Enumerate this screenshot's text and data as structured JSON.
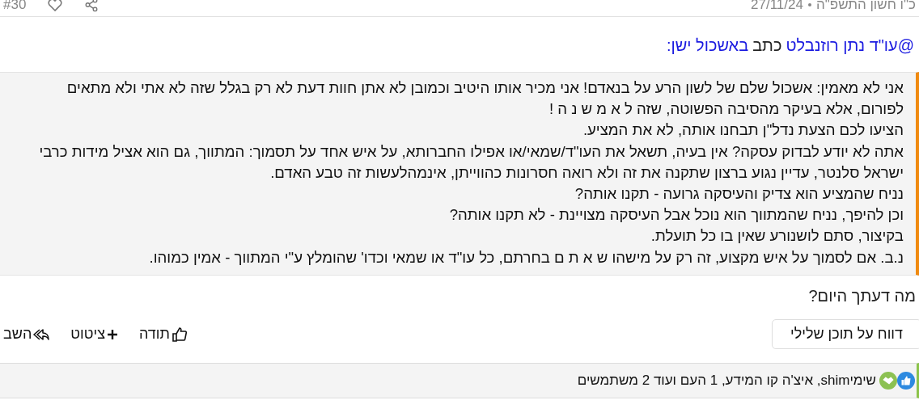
{
  "post_header": {
    "hebrew_date": "כ\"ו חשון התשפ\"ה",
    "date": "27/11/24",
    "post_number": "#30"
  },
  "quote": {
    "author": "@עו\"ד נתן רוזנבלט",
    "verb": "כתב",
    "source": "באשכול ישן:",
    "lines": [
      "אני לא מאמין: אשכול שלם של לשון הרע על בנאדם! אני מכיר אותו היטיב וכמובן לא אתן חוות דעת לא רק בגלל שזה לא אתי ולא מתאים",
      "לפורום, אלא בעיקר מהסיבה הפשוטה, שזה ל א מ ש נ ה !",
      "הציעו לכם הצעת נדל\"ן תבחנו אותה, לא את המציע.",
      "אתה לא יודע לבדוק עסקה? אין בעיה, תשאל את העו\"ד/שמאי/או אפילו החברותא, על איש אחד על תסמוך: המתווך, גם הוא אציל מידות כרבי",
      "ישראל סלנטר, עדיין נגוע ברצון שתקנה את זה ולא רואה חסרונות כהווייתן, אינמהלעשות זה טבע האדם.",
      "נניח שהמציע הוא צדיק והעיסקה גרועה - תקנו אותה?",
      "וכן להיפך, נניח שהמתווך הוא נוכל אבל העיסקה מצויינת - לא תקנו אותה?",
      "בקיצור, סתם לושנורע שאין בו כל תועלת.",
      "נ.ב. אם לסמוך על איש מקצוע, זה רק על מישהו ש א ת ם בחרתם, כל עו\"ד או שמאי וכדו' שהומלץ ע\"י המתווך - אמין כמוהו."
    ]
  },
  "question": "מה דעתך היום?",
  "report_button": "דווח על תוכן שלילי",
  "actions": [
    {
      "kind": "like",
      "label": "תודה"
    },
    {
      "kind": "quote",
      "label": "ציטוט"
    },
    {
      "kind": "reply",
      "label": "השב"
    }
  ],
  "reactions": {
    "text": "שימיshim, איצ'ה קו המידע, 1 העם ועוד 2 משתמשים"
  }
}
